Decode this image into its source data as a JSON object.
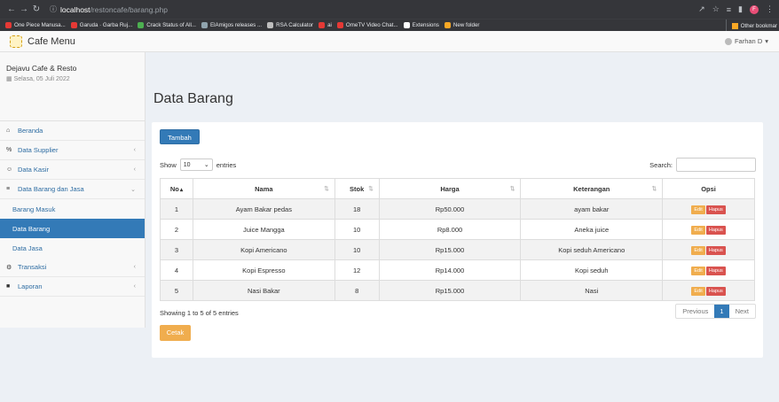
{
  "browser": {
    "url_host": "localhost",
    "url_path": "/restoncafe/barang.php",
    "profile_initial": "F",
    "bookmarks": [
      {
        "label": "One Piece Manusa...",
        "color": "#e53935"
      },
      {
        "label": "Garuda · Garba Ruj...",
        "color": "#e53935"
      },
      {
        "label": "Crack Status of All...",
        "color": "#4caf50"
      },
      {
        "label": "ElAmigos releases ...",
        "color": "#90a4ae"
      },
      {
        "label": "RSA Calculator",
        "color": "#bdbdbd"
      },
      {
        "label": "ai",
        "color": "#e53935"
      },
      {
        "label": "OmeTV Video Chat...",
        "color": "#e53935"
      },
      {
        "label": "Extensions",
        "color": "#ffffff"
      },
      {
        "label": "New folder",
        "color": "#f9a825"
      }
    ],
    "other_bookmarks": "Other bookmar"
  },
  "header": {
    "title": "Cafe Menu",
    "user": "Farhan D"
  },
  "sidebar": {
    "brand": "Dejavu Cafe & Resto",
    "date": "Selasa, 05 Juli 2022",
    "items": [
      {
        "label": "Beranda",
        "icon": "home-icon",
        "glyph": "⌂",
        "has_chevron": false
      },
      {
        "label": "Data Supplier",
        "icon": "link-icon",
        "glyph": "%",
        "has_chevron": true
      },
      {
        "label": "Data Kasir",
        "icon": "users-icon",
        "glyph": "☺",
        "has_chevron": true
      },
      {
        "label": "Data Barang dan Jasa",
        "icon": "table-icon",
        "glyph": "≡",
        "has_chevron": true
      }
    ],
    "sub_items": [
      {
        "label": "Barang Masuk",
        "active": false
      },
      {
        "label": "Data Barang",
        "active": true
      },
      {
        "label": "Data Jasa",
        "active": false
      }
    ],
    "items_after": [
      {
        "label": "Transaksi",
        "icon": "gear-icon",
        "glyph": "⚙"
      },
      {
        "label": "Laporan",
        "icon": "folder-icon",
        "glyph": "■"
      }
    ]
  },
  "main": {
    "page_title": "Data Barang",
    "add_button": "Tambah",
    "show_label": "Show",
    "entries_value": "10",
    "entries_label": "entries",
    "search_label": "Search:",
    "columns": [
      "No",
      "Nama",
      "Stok",
      "Harga",
      "Keterangan",
      "Opsi"
    ],
    "rows": [
      {
        "no": "1",
        "nama": "Ayam Bakar pedas",
        "stok": "18",
        "harga": "Rp50.000",
        "keterangan": "ayam bakar"
      },
      {
        "no": "2",
        "nama": "Juice Mangga",
        "stok": "10",
        "harga": "Rp8.000",
        "keterangan": "Aneka juice"
      },
      {
        "no": "3",
        "nama": "Kopi Americano",
        "stok": "10",
        "harga": "Rp15.000",
        "keterangan": "Kopi seduh Americano"
      },
      {
        "no": "4",
        "nama": "Kopi Espresso",
        "stok": "12",
        "harga": "Rp14.000",
        "keterangan": "Kopi seduh"
      },
      {
        "no": "5",
        "nama": "Nasi Bakar",
        "stok": "8",
        "harga": "Rp15.000",
        "keterangan": "Nasi"
      }
    ],
    "edit_label": "Edit",
    "delete_label": "Hapus",
    "info": "Showing 1 to 5 of 5 entries",
    "pagination": {
      "previous": "Previous",
      "current": "1",
      "next": "Next"
    },
    "print_button": "Cetak"
  }
}
